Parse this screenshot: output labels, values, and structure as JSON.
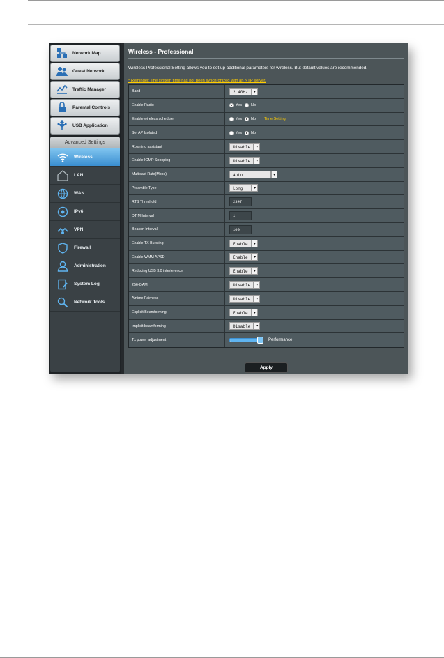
{
  "sidebar": {
    "top_items": [
      {
        "label": "Network Map",
        "icon": "network-map-icon"
      },
      {
        "label": "Guest Network",
        "icon": "guest-network-icon"
      },
      {
        "label": "Traffic Manager",
        "icon": "traffic-manager-icon"
      },
      {
        "label": "Parental Controls",
        "icon": "parental-controls-icon"
      },
      {
        "label": "USB Application",
        "icon": "usb-application-icon"
      }
    ],
    "advanced_title": "Advanced Settings",
    "advanced_items": [
      {
        "label": "Wireless",
        "icon": "wireless-icon",
        "active": true
      },
      {
        "label": "LAN",
        "icon": "lan-icon"
      },
      {
        "label": "WAN",
        "icon": "wan-icon"
      },
      {
        "label": "IPv6",
        "icon": "ipv6-icon"
      },
      {
        "label": "VPN",
        "icon": "vpn-icon"
      },
      {
        "label": "Firewall",
        "icon": "firewall-icon"
      },
      {
        "label": "Administration",
        "icon": "administration-icon"
      },
      {
        "label": "System Log",
        "icon": "system-log-icon"
      },
      {
        "label": "Network Tools",
        "icon": "network-tools-icon"
      }
    ]
  },
  "main": {
    "title": "Wireless - Professional",
    "description": "Wireless Professional Setting allows you to set up additional parameters for wireless. But default values are recommended.",
    "reminder": "* Reminder: The system time has not been synchronized with an NTP server.",
    "rows": {
      "band": {
        "label": "Band",
        "value": "2.4GHz"
      },
      "enable_radio": {
        "label": "Enable Radio",
        "yes": "Yes",
        "no": "No"
      },
      "scheduler": {
        "label": "Enable wireless scheduler",
        "yes": "Yes",
        "no": "No",
        "link": "Time Setting"
      },
      "ap_isolated": {
        "label": "Set AP Isolated",
        "yes": "Yes",
        "no": "No"
      },
      "roaming": {
        "label": "Roaming assistant",
        "value": "Disable"
      },
      "igmp": {
        "label": "Enable IGMP Snooping",
        "value": "Disable"
      },
      "multicast": {
        "label": "Multicast Rate(Mbps)",
        "value": "Auto"
      },
      "preamble": {
        "label": "Preamble Type",
        "value": "Long"
      },
      "rts": {
        "label": "RTS Threshold",
        "value": "2347"
      },
      "dtim": {
        "label": "DTIM Interval",
        "value": "1"
      },
      "beacon": {
        "label": "Beacon Interval",
        "value": "100"
      },
      "tx_bursting": {
        "label": "Enable TX Bursting",
        "value": "Enable"
      },
      "wmm_apsd": {
        "label": "Enable WMM APSD",
        "value": "Enable"
      },
      "usb3": {
        "label": "Reducing USB 3.0 interference",
        "value": "Enable"
      },
      "qam256": {
        "label": "256-QAM",
        "value": "Disable"
      },
      "airtime": {
        "label": "Airtime Fairness",
        "value": "Disable"
      },
      "explicit_bf": {
        "label": "Explicit Beamforming",
        "value": "Enable"
      },
      "implicit_bf": {
        "label": "Implicit beamforming",
        "value": "Disable"
      },
      "tx_power": {
        "label": "Tx power adjustment",
        "value_label": "Performance",
        "level": 1.0
      }
    },
    "apply_label": "Apply"
  }
}
